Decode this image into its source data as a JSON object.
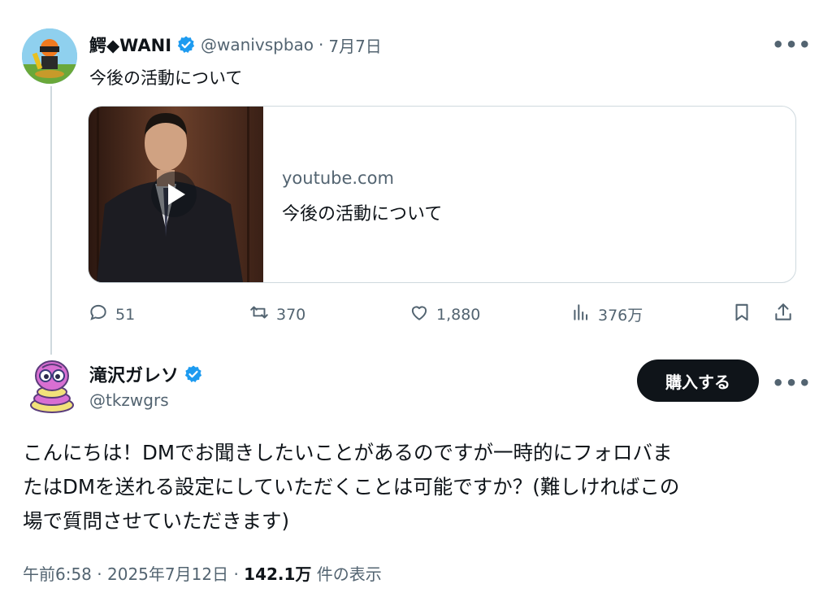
{
  "tweet": {
    "author_name": "鰐◆WANI",
    "handle": "@wanivspbao",
    "separator": "·",
    "date": "7月7日",
    "text": "今後の活動について",
    "card": {
      "domain": "youtube.com",
      "title": "今後の活動について"
    },
    "actions": {
      "replies": "51",
      "reposts": "370",
      "likes": "1,880",
      "views": "376万"
    }
  },
  "reply": {
    "author_name": "滝沢ガレソ",
    "handle": "@tkzwgrs",
    "buy_label": "購入する",
    "text_lines": [
      "こんにちは！DMでお聞きしたいことがあるのですが一時的にフォロバま",
      "たはDMを送れる設定にしていただくことは可能ですか？(難しければこの",
      "場で質問させていただきます)"
    ],
    "time": "午前6:58",
    "separator": "·",
    "date": "2025年7月12日",
    "views_count": "142.1万",
    "views_label": "件の表示"
  },
  "colors": {
    "verified": "#1d9bf0",
    "secondary_text": "#536471",
    "button_bg": "#0f1419"
  },
  "icons": [
    "more-icon",
    "verified-icon",
    "play-icon",
    "reply-icon",
    "repost-icon",
    "like-icon",
    "views-icon",
    "bookmark-icon",
    "share-icon"
  ]
}
